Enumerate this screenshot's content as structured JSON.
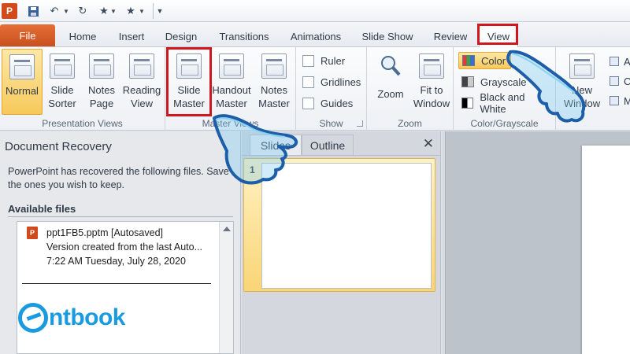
{
  "quick_access": {
    "app_icon": "P",
    "icons": [
      "save-icon",
      "undo-icon",
      "redo-icon",
      "star-icon",
      "customize-icon"
    ]
  },
  "tabs": {
    "file": "File",
    "home": "Home",
    "insert": "Insert",
    "design": "Design",
    "transitions": "Transitions",
    "animations": "Animations",
    "slideshow": "Slide Show",
    "review": "Review",
    "view": "View"
  },
  "ribbon": {
    "presentation_views": {
      "label": "Presentation Views",
      "normal": "Normal",
      "slide_sorter": "Slide\nSorter",
      "notes_page": "Notes\nPage",
      "reading_view": "Reading\nView"
    },
    "master_views": {
      "label": "Master Views",
      "slide_master": "Slide\nMaster",
      "handout_master": "Handout\nMaster",
      "notes_master": "Notes\nMaster"
    },
    "show": {
      "label": "Show",
      "ruler": "Ruler",
      "gridlines": "Gridlines",
      "guides": "Guides"
    },
    "zoom": {
      "label": "Zoom",
      "zoom": "Zoom",
      "fit_window": "Fit to\nWindow"
    },
    "color_grayscale": {
      "label": "Color/Grayscale",
      "color": "Color",
      "grayscale": "Grayscale",
      "black_white": "Black and White"
    },
    "window": {
      "new_window": "New\nWindow",
      "mini_arrange": "A",
      "mini_cascade": "C",
      "mini_move": "M"
    }
  },
  "recovery": {
    "title": "Document Recovery",
    "message": "PowerPoint has recovered the following files.  Save the ones you wish to keep.",
    "available_label": "Available files",
    "file": {
      "name": "ppt1FB5.pptm  [Autosaved]",
      "description": "Version created from the last Auto...",
      "date": "7:22 AM Tuesday, July 28, 2020"
    }
  },
  "logo": {
    "text": "ntbook"
  },
  "slides_panel": {
    "tab_slides": "Slides",
    "tab_outline": "Outline",
    "close": "✕",
    "slide_number": "1"
  },
  "colors": {
    "file_tab": "#d0501f",
    "highlight_red": "#d2161e",
    "selected_gold": "#f7c95b",
    "logo_blue": "#1a9be0",
    "hand_outline": "#1d5ea8"
  }
}
